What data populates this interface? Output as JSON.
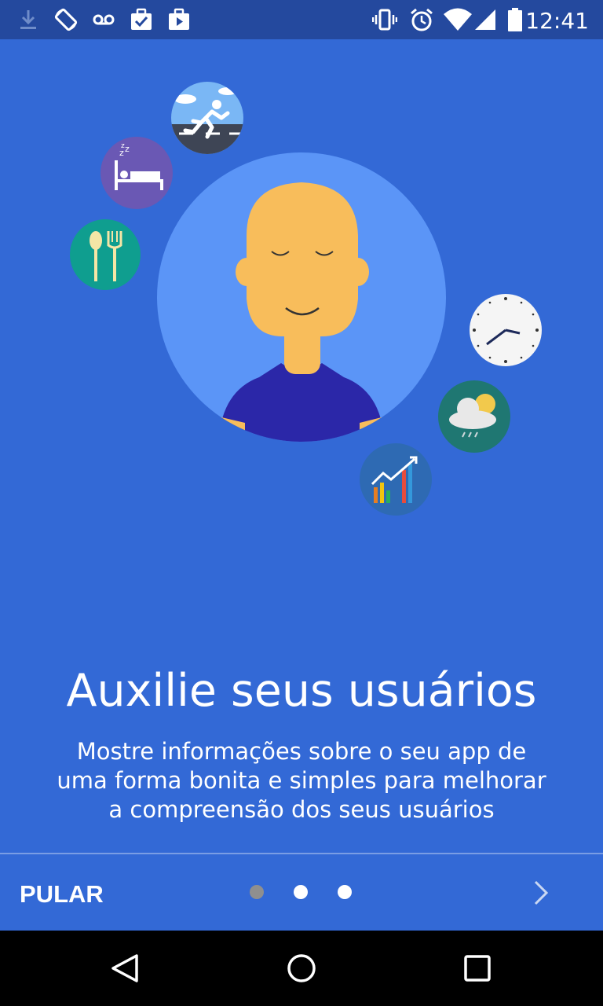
{
  "status_bar": {
    "time": "12:41",
    "left_icons": [
      "download-icon",
      "screen-rotation-icon",
      "voicemail-icon",
      "work-check-icon",
      "play-store-icon"
    ],
    "right_icons": [
      "vibrate-icon",
      "alarm-icon",
      "wifi-icon",
      "signal-icon",
      "battery-icon"
    ]
  },
  "illustration": {
    "center": "person-avatar",
    "bubbles": [
      "running-icon",
      "sleep-icon",
      "food-icon",
      "clock-icon",
      "weather-icon",
      "chart-icon"
    ]
  },
  "main": {
    "title": "Auxilie seus usuários",
    "description": "Mostre informações sobre o seu app de uma forma bonita e simples para melhorar a compreensão dos seus usuários"
  },
  "footer": {
    "skip_label": "PULAR",
    "page_count": 3,
    "current_page": 1,
    "next_icon": "chevron-right-icon"
  },
  "nav_bar": {
    "icons": [
      "back-icon",
      "home-icon",
      "recents-icon"
    ]
  },
  "colors": {
    "background": "#3369d6",
    "status_bar": "#24499e",
    "avatar_circle": "#5b95f7",
    "skin": "#f8bd5b",
    "shirt": "#2b27a8"
  }
}
